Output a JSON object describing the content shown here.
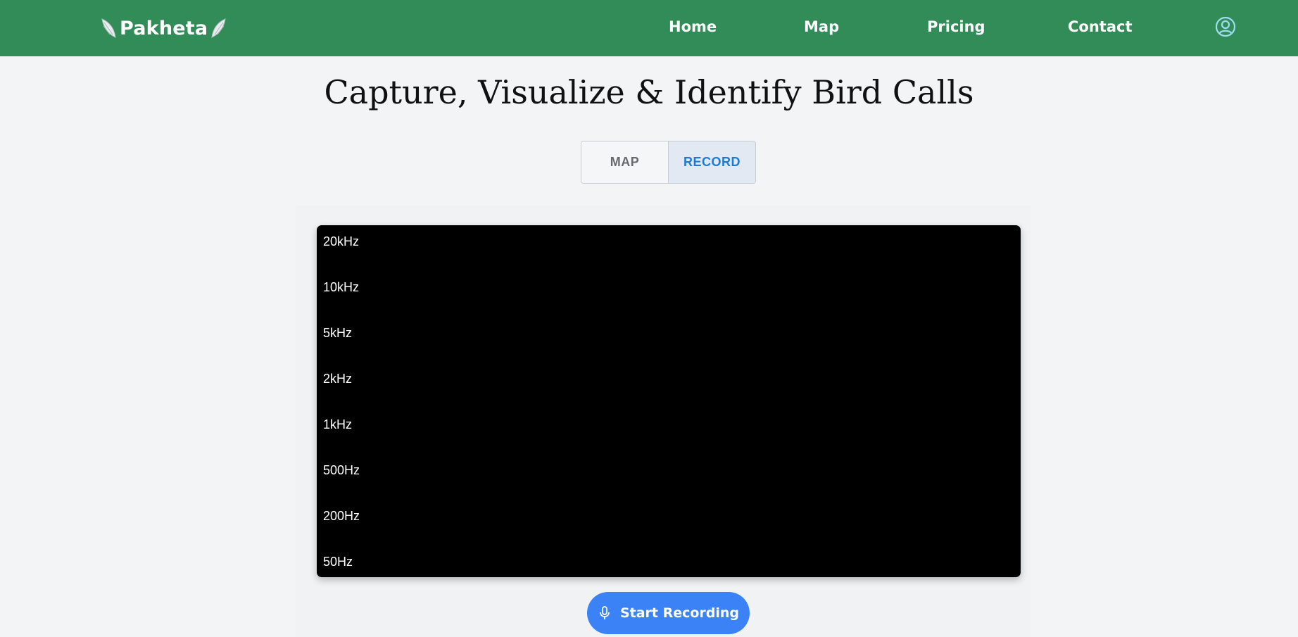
{
  "navbar": {
    "brand": "Pakheta",
    "links": [
      "Home",
      "Map",
      "Pricing",
      "Contact"
    ],
    "user_icon": "user-circle-icon",
    "color": "#318c57"
  },
  "headline": "Capture, Visualize & Identify Bird Calls",
  "toggle": {
    "map_label": "MAP",
    "record_label": "RECORD",
    "active": "RECORD",
    "active_color": "#1f7bd1"
  },
  "spectrogram": {
    "frequency_labels": [
      "20kHz",
      "10kHz",
      "5kHz",
      "2kHz",
      "1kHz",
      "500Hz",
      "200Hz",
      "50Hz"
    ],
    "background": "#000000"
  },
  "record_button": {
    "label": "Start Recording",
    "icon": "microphone-icon",
    "color": "#3b82f6"
  }
}
